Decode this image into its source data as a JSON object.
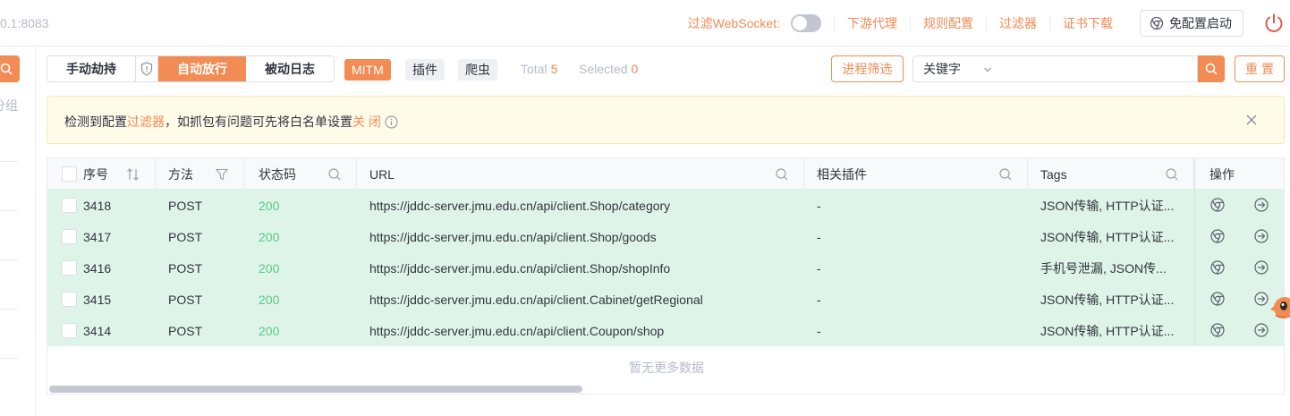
{
  "topbar": {
    "address": "0.1:8083",
    "websocket_label": "过滤WebSocket:",
    "links": [
      "下游代理",
      "规则配置",
      "过滤器",
      "证书下载"
    ],
    "launch_label": "免配置启动"
  },
  "leftpanel": {
    "text": "分组"
  },
  "toolbar": {
    "seg": [
      "手动劫持",
      "自动放行",
      "被动日志"
    ],
    "tags": [
      "MITM",
      "插件",
      "爬虫"
    ],
    "total_label": "Total",
    "total": "5",
    "selected_label": "Selected",
    "selected": "0",
    "process_filter": "进程筛选",
    "keyword_select": "关键字",
    "search_placeholder": "",
    "reset": "重置"
  },
  "alert": {
    "prefix": "检测到配置",
    "link": "过滤器",
    "middle": "，如抓包有问题可先将白名单设置",
    "close_link": "关 闭"
  },
  "table": {
    "columns": [
      "序号",
      "方法",
      "状态码",
      "URL",
      "相关插件",
      "Tags",
      "操作"
    ],
    "rows": [
      {
        "id": "3418",
        "method": "POST",
        "status": "200",
        "url": "https://jddc-server.jmu.edu.cn/api/client.Shop/category",
        "plugin": "-",
        "tags": "JSON传输, HTTP认证..."
      },
      {
        "id": "3417",
        "method": "POST",
        "status": "200",
        "url": "https://jddc-server.jmu.edu.cn/api/client.Shop/goods",
        "plugin": "-",
        "tags": "JSON传输, HTTP认证..."
      },
      {
        "id": "3416",
        "method": "POST",
        "status": "200",
        "url": "https://jddc-server.jmu.edu.cn/api/client.Shop/shopInfo",
        "plugin": "-",
        "tags": "手机号泄漏, JSON传..."
      },
      {
        "id": "3415",
        "method": "POST",
        "status": "200",
        "url": "https://jddc-server.jmu.edu.cn/api/client.Cabinet/getRegional",
        "plugin": "-",
        "tags": "JSON传输, HTTP认证..."
      },
      {
        "id": "3414",
        "method": "POST",
        "status": "200",
        "url": "https://jddc-server.jmu.edu.cn/api/client.Coupon/shop",
        "plugin": "-",
        "tags": "JSON传输, HTTP认证..."
      }
    ],
    "empty_text": "暂无更多数据"
  },
  "colors": {
    "accent": "#f28b54",
    "row_bg": "#dff4e8",
    "status_green": "#56c987"
  }
}
